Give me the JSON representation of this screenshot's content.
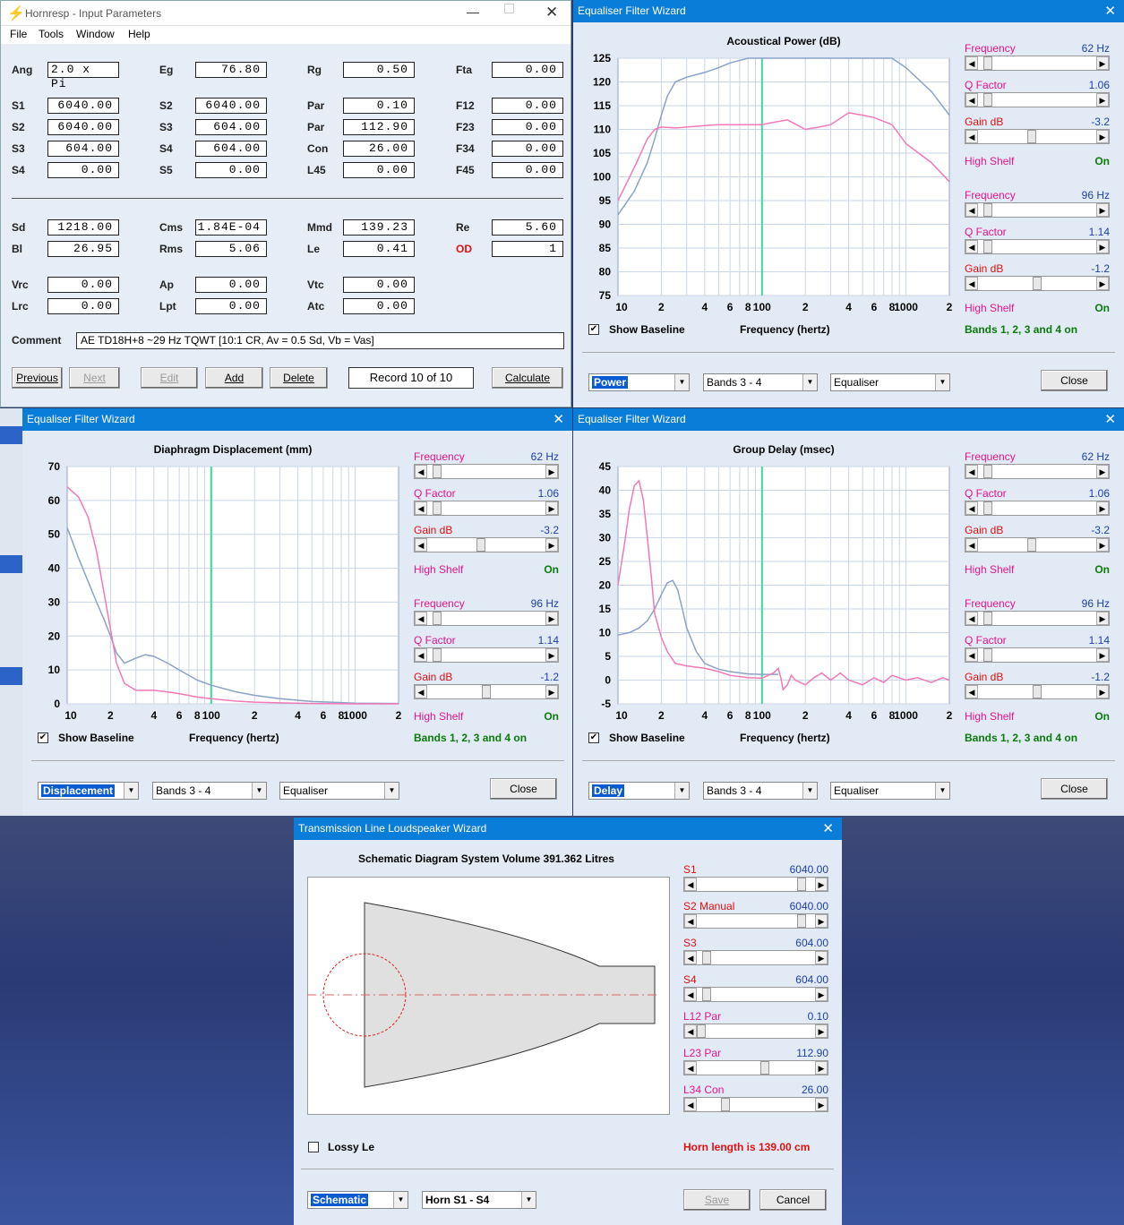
{
  "input_window": {
    "title": "Hornresp - Input Parameters",
    "menu": [
      "File",
      "Tools",
      "Window",
      "Help"
    ],
    "params": [
      {
        "label": "Ang",
        "value": "2.0 x Pi"
      },
      {
        "label": "Eg",
        "value": "76.80"
      },
      {
        "label": "Rg",
        "value": "0.50"
      },
      {
        "label": "Fta",
        "value": "0.00"
      },
      {
        "label": "S1",
        "value": "6040.00"
      },
      {
        "label": "S2",
        "value": "6040.00"
      },
      {
        "label": "Par",
        "value": "0.10"
      },
      {
        "label": "F12",
        "value": "0.00"
      },
      {
        "label": "S2",
        "value": "6040.00"
      },
      {
        "label": "S3",
        "value": "604.00"
      },
      {
        "label": "Par",
        "value": "112.90"
      },
      {
        "label": "F23",
        "value": "0.00"
      },
      {
        "label": "S3",
        "value": "604.00"
      },
      {
        "label": "S4",
        "value": "604.00"
      },
      {
        "label": "Con",
        "value": "26.00"
      },
      {
        "label": "F34",
        "value": "0.00"
      },
      {
        "label": "S4",
        "value": "0.00"
      },
      {
        "label": "S5",
        "value": "0.00"
      },
      {
        "label": "L45",
        "value": "0.00"
      },
      {
        "label": "F45",
        "value": "0.00"
      },
      {
        "label": "Sd",
        "value": "1218.00"
      },
      {
        "label": "Cms",
        "value": "1.84E-04"
      },
      {
        "label": "Mmd",
        "value": "139.23"
      },
      {
        "label": "Re",
        "value": "5.60"
      },
      {
        "label": "Bl",
        "value": "26.95"
      },
      {
        "label": "Rms",
        "value": "5.06"
      },
      {
        "label": "Le",
        "value": "0.41"
      },
      {
        "label": "OD",
        "value": "1"
      },
      {
        "label": "Vrc",
        "value": "0.00"
      },
      {
        "label": "Ap",
        "value": "0.00"
      },
      {
        "label": "Vtc",
        "value": "0.00"
      },
      {
        "label": "Lrc",
        "value": "0.00"
      },
      {
        "label": "Lpt",
        "value": "0.00"
      },
      {
        "label": "Atc",
        "value": "0.00"
      }
    ],
    "comment_label": "Comment",
    "comment": "AE TD18H+8 ~29 Hz TQWT [10:1 CR, Av = 0.5 Sd, Vb = Vas]",
    "buttons": {
      "previous": "Previous",
      "next": "Next",
      "edit": "Edit",
      "add": "Add",
      "delete": "Delete",
      "record": "Record 10 of 10",
      "calculate": "Calculate"
    }
  },
  "eq_common": {
    "title": "Equaliser Filter Wizard",
    "bands": [
      {
        "freq_label": "Frequency",
        "freq": "62 Hz",
        "q_label": "Q Factor",
        "q": "1.06",
        "gain_label": "Gain  dB",
        "gain": "-3.2",
        "shelf_label": "High Shelf",
        "shelf": "On"
      },
      {
        "freq_label": "Frequency",
        "freq": "96 Hz",
        "q_label": "Q Factor",
        "q": "1.14",
        "gain_label": "Gain  dB",
        "gain": "-1.2",
        "shelf_label": "High Shelf",
        "shelf": "On"
      }
    ],
    "show_baseline": "Show Baseline",
    "xlabel": "Frequency (hertz)",
    "bands_status": "Bands 1, 2, 3 and 4 on",
    "combo_bands": "Bands 3 - 4",
    "combo_eq": "Equaliser",
    "close": "Close",
    "x_ticks": [
      "10",
      "2",
      "4",
      "6",
      "8",
      "100",
      "2",
      "4",
      "6",
      "8",
      "1000",
      "2"
    ]
  },
  "power_window": {
    "chart_title": "Acoustical Power (dB)",
    "mode": "Power"
  },
  "disp_window": {
    "chart_title": "Diaphragm Displacement (mm)",
    "mode": "Displacement"
  },
  "delay_window": {
    "chart_title": "Group Delay (msec)",
    "mode": "Delay"
  },
  "tl_window": {
    "title": "Transmission Line Loudspeaker Wizard",
    "schematic_title": "Schematic Diagram   System Volume 391.362 Litres",
    "sliders": [
      {
        "label": "S1",
        "value": "6040.00",
        "pos": 0.92
      },
      {
        "label": "S2  Manual",
        "value": "6040.00",
        "pos": 0.92
      },
      {
        "label": "S3",
        "value": "604.00",
        "pos": 0.05
      },
      {
        "label": "S4",
        "value": "604.00",
        "pos": 0.05
      },
      {
        "label": "L12  Par",
        "value": "0.10",
        "pos": 0.0
      },
      {
        "label": "L23  Par",
        "value": "112.90",
        "pos": 0.58
      },
      {
        "label": "L34  Con",
        "value": "26.00",
        "pos": 0.22
      }
    ],
    "lossy": "Lossy Le",
    "horn_length": "Horn length is 139.00 cm",
    "combo_mode": "Schematic",
    "combo_horn": "Horn S1 - S4",
    "save": "Save",
    "cancel": "Cancel"
  },
  "chart_data": [
    {
      "type": "line",
      "title": "Acoustical Power (dB)",
      "xlabel": "Frequency (hertz)",
      "ylabel": "",
      "x_scale": "log",
      "xlim": [
        10,
        2000
      ],
      "ylim": [
        75,
        125
      ],
      "yticks": [
        75,
        80,
        85,
        90,
        95,
        100,
        105,
        110,
        115,
        120,
        125
      ],
      "marker_x": 100,
      "series": [
        {
          "color": "#8aa2c8",
          "x": [
            10,
            13,
            16,
            18,
            20,
            22,
            25,
            30,
            40,
            50,
            60,
            80,
            100,
            150,
            200,
            300,
            400,
            500,
            600,
            800,
            1000,
            1500,
            2000
          ],
          "y": [
            92,
            97,
            103,
            108,
            113,
            117,
            120,
            121,
            122,
            123,
            124,
            125,
            125,
            125,
            125,
            125,
            125,
            125,
            125,
            125,
            123,
            118,
            113
          ]
        },
        {
          "color": "#f07ab8",
          "x": [
            10,
            13,
            16,
            18,
            20,
            25,
            30,
            40,
            50,
            60,
            80,
            100,
            120,
            150,
            200,
            250,
            300,
            400,
            500,
            600,
            800,
            1000,
            1500,
            2000
          ],
          "y": [
            95,
            102,
            108,
            110,
            110.5,
            110.3,
            110.5,
            110.8,
            111,
            111,
            111,
            111,
            111.5,
            112,
            110,
            110.5,
            111,
            113.5,
            113,
            112.5,
            111,
            107,
            103,
            99
          ]
        }
      ]
    },
    {
      "type": "line",
      "title": "Diaphragm Displacement (mm)",
      "xlabel": "Frequency (hertz)",
      "ylabel": "",
      "x_scale": "log",
      "xlim": [
        10,
        2000
      ],
      "ylim": [
        0,
        70
      ],
      "yticks": [
        0,
        10,
        20,
        30,
        40,
        50,
        60,
        70
      ],
      "marker_x": 100,
      "series": [
        {
          "color": "#8aa2c8",
          "x": [
            10,
            12,
            14,
            16,
            18,
            20,
            22,
            25,
            30,
            35,
            40,
            50,
            60,
            80,
            100,
            150,
            200,
            300,
            500,
            1000,
            2000
          ],
          "y": [
            52,
            43,
            36,
            30,
            25,
            20,
            15,
            12,
            13.5,
            14.5,
            14,
            12,
            10,
            7,
            5.5,
            3.5,
            2.5,
            1.5,
            0.7,
            0.2,
            0.1
          ]
        },
        {
          "color": "#f07ab8",
          "x": [
            10,
            12,
            14,
            16,
            18,
            20,
            22,
            25,
            30,
            40,
            50,
            60,
            80,
            100,
            150,
            200,
            300,
            500,
            1000,
            2000
          ],
          "y": [
            64,
            61,
            55,
            45,
            33,
            22,
            12,
            6,
            4,
            4,
            3.5,
            3,
            2,
            1.5,
            0.8,
            0.5,
            0.3,
            0.1,
            0,
            0
          ]
        }
      ]
    },
    {
      "type": "line",
      "title": "Group Delay (msec)",
      "xlabel": "Frequency (hertz)",
      "ylabel": "",
      "x_scale": "log",
      "xlim": [
        10,
        2000
      ],
      "ylim": [
        -5,
        45
      ],
      "yticks": [
        -5,
        0,
        5,
        10,
        15,
        20,
        25,
        30,
        35,
        40,
        45
      ],
      "marker_x": 100,
      "series": [
        {
          "color": "#8aa2c8",
          "x": [
            10,
            12,
            14,
            16,
            18,
            20,
            22,
            24,
            26,
            28,
            30,
            35,
            40,
            50,
            60,
            80,
            100,
            130
          ],
          "y": [
            9.5,
            10,
            11,
            12.5,
            15,
            18,
            20.5,
            21,
            19,
            15,
            11,
            6,
            3.5,
            2.3,
            1.8,
            1.3,
            1.2,
            1.2
          ]
        },
        {
          "color": "#f07ab8",
          "x": [
            10,
            11,
            12,
            13,
            14,
            15,
            16,
            17,
            18,
            20,
            22,
            25,
            30,
            40,
            50,
            60,
            80,
            100,
            120,
            130,
            135,
            140,
            150,
            160,
            170,
            200,
            230,
            260,
            300,
            350,
            400,
            500,
            600,
            700,
            800,
            1000,
            1200,
            1500,
            1800,
            2000
          ],
          "y": [
            20,
            28,
            36,
            41,
            42,
            38,
            30,
            22,
            14,
            9,
            6,
            3.5,
            3,
            2.5,
            1.8,
            1,
            0.5,
            0.4,
            1.5,
            2.5,
            0.5,
            -2,
            -1,
            1,
            0,
            -1,
            0.5,
            1.5,
            0,
            1.5,
            0,
            -1,
            0.5,
            -0.5,
            1,
            0,
            0.5,
            -0.5,
            0.5,
            0
          ]
        }
      ]
    }
  ]
}
